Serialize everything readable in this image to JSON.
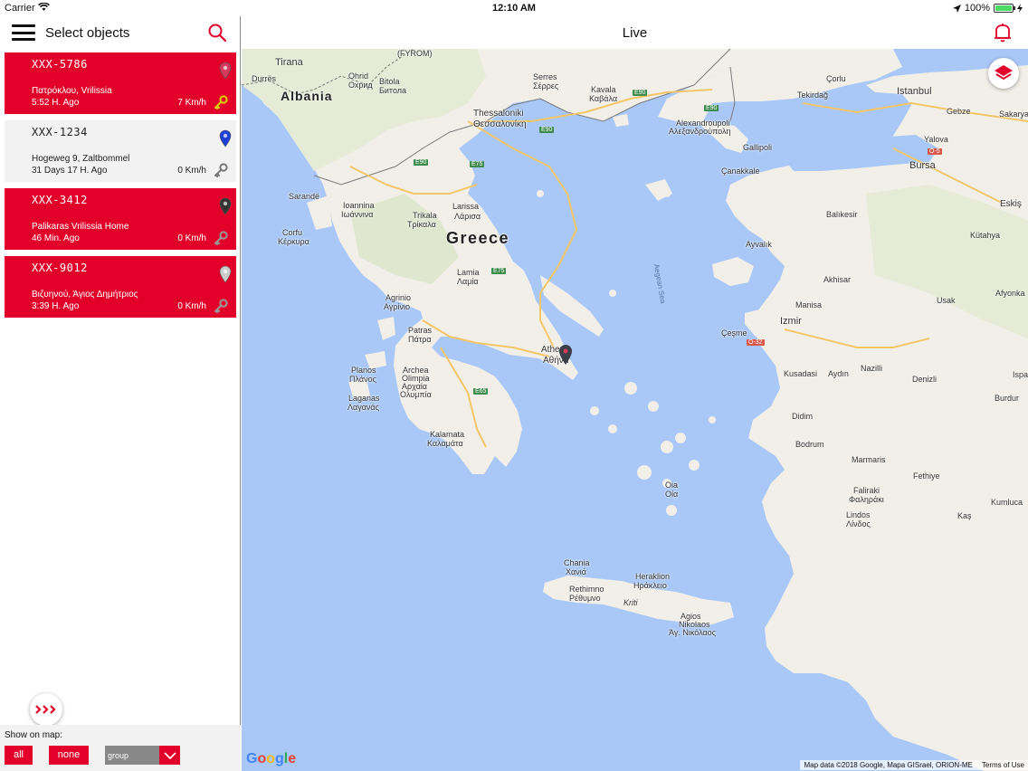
{
  "status": {
    "carrier": "Carrier",
    "time": "12:10 AM",
    "battery": "100%"
  },
  "left": {
    "title": "Select objects",
    "items": [
      {
        "plate": "XXX-5786",
        "address": "Πατρόκλου, Vrilissia",
        "ago": "5:52 H. Ago",
        "speed": "7 Km/h",
        "style": "red",
        "pin_color": "#d43a5a",
        "key_color": "#d9d400"
      },
      {
        "plate": "XXX-1234",
        "address": "Hogeweg 9, Zaltbommel",
        "ago": "31 Days 17 H. Ago",
        "speed": "0 Km/h",
        "style": "grey",
        "pin_color": "#1f3fd8",
        "key_color": "#777777"
      },
      {
        "plate": "XXX-3412",
        "address": "Palikaras Vrilissia Home",
        "ago": "46 Min. Ago",
        "speed": "0 Km/h",
        "style": "red",
        "pin_color": "#333333",
        "key_color": "#999999"
      },
      {
        "plate": "XXX-9012",
        "address": "Βιζυηνού, Άγιος Δημήτριος",
        "ago": "3:39 H. Ago",
        "speed": "0 Km/h",
        "style": "red",
        "pin_color": "#cccccc",
        "key_color": "#999999"
      }
    ],
    "show_on_map_label": "Show on map:",
    "all_label": "all",
    "none_label": "none",
    "group_label": "group"
  },
  "right": {
    "title": "Live"
  },
  "map": {
    "labels": {
      "albania": "Albania",
      "greece": "Greece",
      "aegean": "Aegean Sea",
      "tirana": "Tirana",
      "durres": "Durrës",
      "ohrid": "Ohrid",
      "ohrid2": "Охрид",
      "bitola": "Bitola",
      "bitola2": "Битола",
      "serres": "Serres",
      "serres2": "Σέρρες",
      "kavala": "Kavala",
      "kavala2": "Καβάλα",
      "corlu": "Çorlu",
      "tekirdag": "Tekirdağ",
      "istanbul": "Istanbul",
      "gebze": "Gebze",
      "sakarya": "Sakarya",
      "yalova": "Yalova",
      "bursa": "Bursa",
      "thessaloniki": "Thessaloniki",
      "thessaloniki2": "Θεσσαλονίκη",
      "alexandroupoli": "Alexandroupoli",
      "alexandroupoli2": "Αλεξανδρούπολη",
      "gallipoli": "Gallipoli",
      "canakkale": "Çanakkale",
      "eskis": "Eskiş",
      "balikesir": "Balıkesir",
      "kutahya": "Kütahya",
      "sarande": "Sarandë",
      "ioannina": "Ioannina",
      "ioannina2": "Ιωάννινα",
      "trikala": "Trikala",
      "trikala2": "Τρίκαλα",
      "larissa": "Larissa",
      "larissa2": "Λάρισα",
      "corfu": "Corfu",
      "corfu2": "Κέρκυρα",
      "ayvalik": "Ayvalık",
      "akhisar": "Akhisar",
      "afyonka": "Afyonka",
      "usak": "Usak",
      "manisa": "Manisa",
      "izmir": "Izmir",
      "cesme": "Çeşme",
      "lamia": "Lamia",
      "lamia2": "Λαμία",
      "agrinio": "Agrinio",
      "agrinio2": "Αγρίνιο",
      "patras": "Patras",
      "patras2": "Πάτρα",
      "athens": "Athens",
      "athens2": "Αθήνα",
      "planos": "Planos",
      "planos2": "Πλάνος",
      "archea": "Archea",
      "olimpia": "Olimpia",
      "archea2": "Αρχαία",
      "olimpia2": "Ολυμπία",
      "laganas": "Laganas",
      "laganas2": "Λαγανάς",
      "kusadasi": "Kusadasi",
      "aydin": "Aydın",
      "nazilli": "Nazilli",
      "denizli": "Denizli",
      "isparta": "Ispa",
      "burdur": "Burdur",
      "kalamata": "Kalamata",
      "kalamata2": "Καλαμάτα",
      "didim": "Didim",
      "bodrum": "Bodrum",
      "marmaris": "Marmaris",
      "fethiye": "Fethiye",
      "oia": "Oia",
      "oia2": "Οία",
      "faliraki": "Faliraki",
      "faliraki2": "Φαληράκι",
      "lindos": "Lindos",
      "lindos2": "Λίνδος",
      "kumluca": "Kumluca",
      "kas": "Kaş",
      "chania": "Chania",
      "chania2": "Χανιά",
      "heraklion": "Heraklion",
      "heraklion2": "Ηράκλειο",
      "rethimno": "Rethimno",
      "rethimno2": "Ρέθυμνο",
      "kriti": "Kriti",
      "agnikolaos": "Agios",
      "agnikolaos2": "Nikolaos",
      "agnikolaos3": "Άγ. Νικόλαος",
      "fyrom": "(FYROM)"
    },
    "roads": [
      "E90",
      "E90",
      "E90",
      "E90",
      "E75",
      "E75",
      "E65",
      "O-5",
      "O-32"
    ],
    "attribution": "Map data ©2018 Google, Mapa GISrael, ORION-ME",
    "terms": "Terms of Use",
    "google": "Google"
  }
}
